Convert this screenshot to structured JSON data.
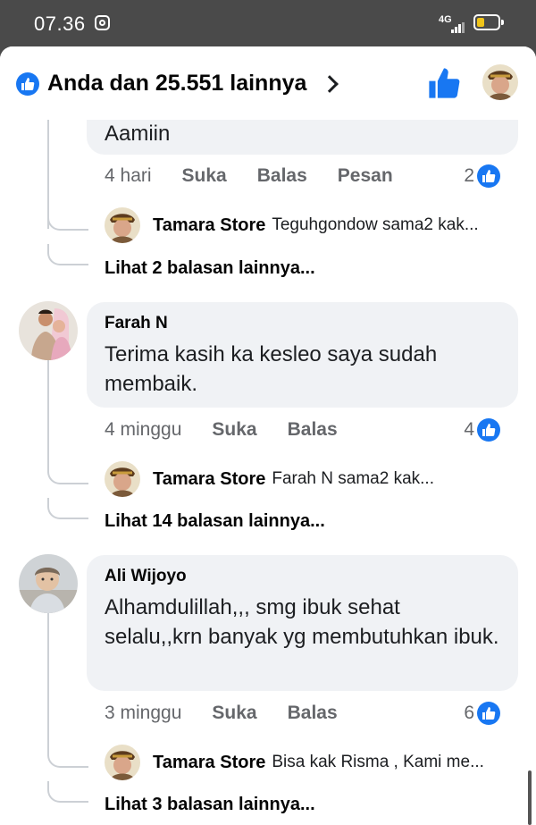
{
  "status_bar": {
    "time": "07.36",
    "network": "4G"
  },
  "header": {
    "reactors": "Anda dan 25.551 lainnya"
  },
  "comments": [
    {
      "name": "",
      "text": "Aamiin",
      "time": "4 hari",
      "actions": [
        "Suka",
        "Balas",
        "Pesan"
      ],
      "reactions": "2",
      "reply": {
        "name": "Tamara Store",
        "text": "Teguhgondow sama2 kak..."
      },
      "more": "Lihat 2 balasan lainnya..."
    },
    {
      "name": "Farah N",
      "text": "Terima kasih ka kesleo saya sudah membaik.",
      "time": "4 minggu",
      "actions": [
        "Suka",
        "Balas"
      ],
      "reactions": "4",
      "reply": {
        "name": "Tamara Store",
        "text": "Farah N sama2 kak..."
      },
      "more": "Lihat 14 balasan lainnya..."
    },
    {
      "name": "Ali Wijoyo",
      "text": "Alhamdulillah,,, smg ibuk sehat selalu,,krn banyak yg membutuhkan ibuk.",
      "time": "3 minggu",
      "actions": [
        "Suka",
        "Balas"
      ],
      "reactions": "6",
      "reply": {
        "name": "Tamara Store",
        "text": "Bisa kak Risma , Kami me..."
      },
      "more": "Lihat 3 balasan lainnya..."
    }
  ],
  "icons": {
    "status_ig": "instagram-icon",
    "battery": "battery-icon",
    "like": "like-icon",
    "chevron": "chevron-right-icon"
  },
  "colors": {
    "accent": "#1877f2",
    "bubble": "#f0f2f5",
    "muted": "#65676b"
  }
}
